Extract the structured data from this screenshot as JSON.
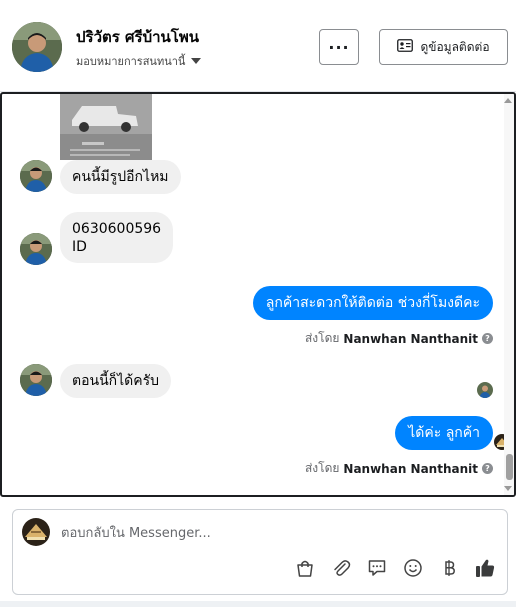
{
  "header": {
    "contact_name": "ปริวัตร ศรีบ้านโพน",
    "assign_label": "มอบหมายการสนทนานี้",
    "more_label": "···",
    "view_contact_label": "ดูข้อมูลติดต่อ"
  },
  "messages": {
    "m1": "คนนี้มีรูปอีกไหม",
    "m2_line1": "0630600596",
    "m2_line2": "ID",
    "m3": "ลูกค้าสะดวกให้ติดต่อ ช่วงกี่โมงดีคะ",
    "m4": "ตอนนี้ก็ได้ครับ",
    "m5": "ได้ค่ะ ลูกค้า"
  },
  "sent_by": {
    "prefix": "ส่งโดย",
    "agent": "Nanwhan Nanthanit"
  },
  "composer": {
    "placeholder": "ตอบกลับใน Messenger..."
  },
  "icons": {
    "bag": "shopping-bag-icon",
    "attach": "paperclip-icon",
    "saved_reply": "speech-bubble-icon",
    "emoji": "emoji-icon",
    "payment": "baht-icon",
    "like": "thumbs-up-icon"
  },
  "colors": {
    "outgoing_bubble": "#0084ff",
    "incoming_bubble": "#f0f0f0"
  }
}
